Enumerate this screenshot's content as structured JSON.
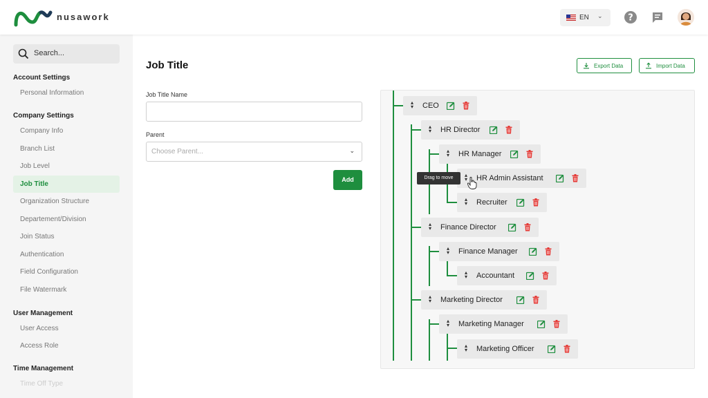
{
  "header": {
    "brand": "nusawork",
    "lang_code": "EN"
  },
  "sidebar": {
    "search_placeholder": "Search...",
    "sections": [
      {
        "title": "Account Settings",
        "items": [
          "Personal Information"
        ]
      },
      {
        "title": "Company Settings",
        "items": [
          "Company Info",
          "Branch List",
          "Job Level",
          "Job Title",
          "Organization Structure",
          "Departement/Division",
          "Join Status",
          "Authentication",
          "Field Configuration",
          "File Watermark"
        ]
      },
      {
        "title": "User Management",
        "items": [
          "User Access",
          "Access Role"
        ]
      },
      {
        "title": "Time Management",
        "items": [
          "Time Off Type"
        ]
      }
    ],
    "active_item": "Job Title"
  },
  "main": {
    "title": "Job Title",
    "export_label": "Export Data",
    "import_label": "Import Data",
    "name_label": "Job Title Name",
    "name_value": "",
    "parent_label": "Parent",
    "parent_placeholder": "Choose Parent...",
    "add_label": "Add"
  },
  "tree": {
    "tooltip": "Drag to move",
    "nodes": [
      "CEO",
      "HR Director",
      "HR Manager",
      "HR Admin Assistant",
      "Recruiter",
      "Finance Director",
      "Finance Manager",
      "Accountant",
      "Marketing Director",
      "Marketing Manager",
      "Marketing Officer"
    ]
  },
  "colors": {
    "accent": "#1e8e3e",
    "danger": "#e53935"
  }
}
